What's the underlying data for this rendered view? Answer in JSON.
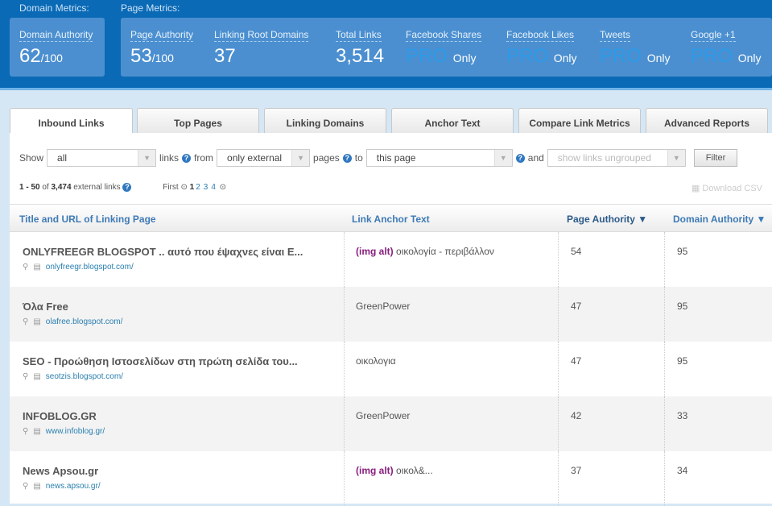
{
  "header": {
    "domain_group": "Domain Metrics:",
    "page_group": "Page Metrics:",
    "domain_metrics": [
      {
        "label": "Domain Authority",
        "value": "62",
        "suffix": "/100"
      }
    ],
    "page_metrics": [
      {
        "label": "Page Authority",
        "value": "53",
        "suffix": "/100"
      },
      {
        "label": "Linking Root Domains",
        "value": "37"
      },
      {
        "label": "Total Links",
        "value": "3,514"
      },
      {
        "label": "Facebook Shares",
        "pro": "PRO",
        "only": "Only"
      },
      {
        "label": "Facebook Likes",
        "pro": "PRO",
        "only": "Only"
      },
      {
        "label": "Tweets",
        "pro": "PRO",
        "only": "Only"
      },
      {
        "label": "Google +1",
        "pro": "PRO",
        "only": "Only"
      }
    ]
  },
  "tabs": [
    "Inbound Links",
    "Top Pages",
    "Linking Domains",
    "Anchor Text",
    "Compare Link Metrics",
    "Advanced Reports"
  ],
  "filter": {
    "show": "Show",
    "show_value": "all",
    "links": "links",
    "from": "from",
    "from_value": "only external",
    "pages": "pages",
    "to": "to",
    "to_value": "this page",
    "and": "and",
    "group_value": "show links ungrouped",
    "filter_button": "Filter"
  },
  "summary": {
    "range": "1 - 50",
    "of": "of",
    "total": "3,474",
    "suffix": "external links",
    "first": "First",
    "pages": [
      "1",
      "2",
      "3",
      "4"
    ]
  },
  "download_csv": "Download CSV",
  "table": {
    "headers": [
      "Title and URL of Linking Page",
      "Link Anchor Text",
      "Page Authority ▼",
      "Domain Authority ▼"
    ],
    "rows": [
      {
        "title": "ONLYFREEGR BLOGSPOT .. αυτό που έψαχνες είναι E...",
        "url": "onlyfreegr.blogspot.com/",
        "alt": "(img alt)",
        "anchor": "οικολογία - περιβάλλον",
        "pa": "54",
        "da": "95"
      },
      {
        "title": "Όλα Free",
        "url": "olafree.blogspot.com/",
        "alt": "",
        "anchor": "GreenPower",
        "pa": "47",
        "da": "95"
      },
      {
        "title": "SEO - Προώθηση Ιστοσελίδων στη πρώτη σελίδα του...",
        "url": "seotzis.blogspot.com/",
        "alt": "",
        "anchor": "οικολογια",
        "pa": "47",
        "da": "95"
      },
      {
        "title": "INFOBLOG.GR",
        "url": "www.infoblog.gr/",
        "alt": "",
        "anchor": "GreenPower",
        "pa": "42",
        "da": "33"
      },
      {
        "title": "News Apsou.gr",
        "url": "news.apsou.gr/",
        "alt": "(img alt)",
        "anchor": "οικολ&...",
        "pa": "37",
        "da": "34"
      }
    ]
  }
}
